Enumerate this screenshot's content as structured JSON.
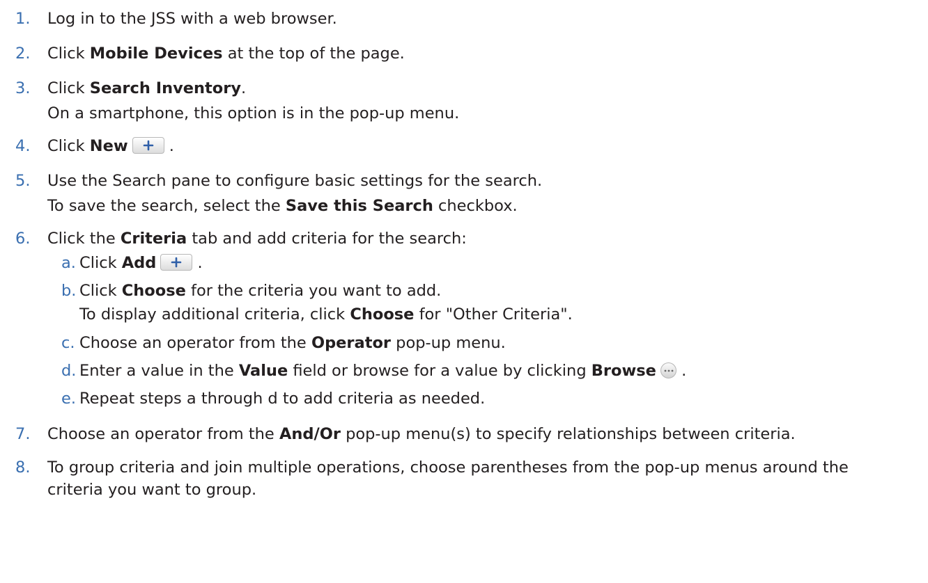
{
  "steps": [
    {
      "num": "1.",
      "text": "Log in to the JSS with a web browser."
    },
    {
      "num": "2.",
      "pre": "Click ",
      "bold": "Mobile Devices",
      "post": " at the top of the page."
    },
    {
      "num": "3.",
      "pre": "Click ",
      "bold": "Search Inventory",
      "post": ".",
      "note": "On a smartphone, this option is in the pop-up menu."
    },
    {
      "num": "4.",
      "pre": "Click ",
      "bold": "New",
      "post": " ."
    },
    {
      "num": "5.",
      "text": "Use the Search pane to configure basic settings for the search.",
      "note_pre": "To save the search, select the ",
      "note_bold": "Save this Search",
      "note_post": " checkbox."
    },
    {
      "num": "6.",
      "pre": "Click the ",
      "bold": "Criteria",
      "post": " tab and add criteria for the search:"
    },
    {
      "num": "7.",
      "pre": "Choose an operator from the ",
      "bold": "And/Or",
      "post": " pop-up menu(s) to specify relationships between criteria."
    },
    {
      "num": "8.",
      "text": "To group criteria and join multiple operations, choose parentheses from the pop-up menus around the",
      "text2": "criteria you want to group."
    }
  ],
  "substeps": [
    {
      "letter": "a.",
      "pre": "Click ",
      "bold": "Add",
      "post": " ."
    },
    {
      "letter": "b.",
      "pre": "Click ",
      "bold": "Choose",
      "post": " for the criteria you want to add.",
      "note_pre": "To display additional criteria, click ",
      "note_bold": "Choose",
      "note_post": " for \"Other Criteria\"."
    },
    {
      "letter": "c.",
      "pre": "Choose an operator from the ",
      "bold": "Operator",
      "post": " pop-up menu."
    },
    {
      "letter": "d.",
      "pre": "Enter a value in the ",
      "bold": "Value",
      "post": " field or browse for a value by clicking ",
      "bold2": "Browse",
      "post2": " ."
    },
    {
      "letter": "e.",
      "text": "Repeat steps a through d to add criteria as needed."
    }
  ],
  "icons": {
    "plus": "plus-button-icon",
    "browse": "ellipsis-browse-icon"
  },
  "colors": {
    "numbering": "#3a6fb0",
    "plus": "#2f5fa8"
  }
}
